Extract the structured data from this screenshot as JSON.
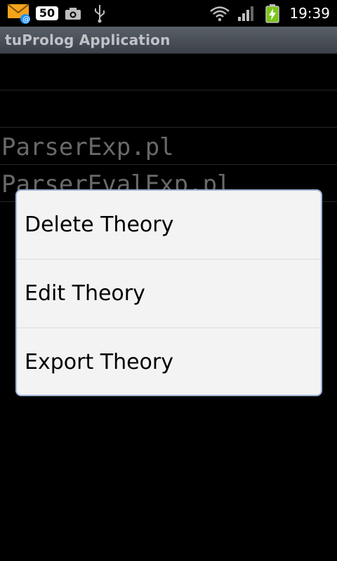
{
  "status_bar": {
    "notification_count": "50",
    "time": "19:39",
    "icons": [
      "mail-icon",
      "camera-icon",
      "usb-icon",
      "wifi-icon",
      "signal-icon",
      "battery-charging-icon"
    ]
  },
  "app": {
    "title": "tuProlog Application"
  },
  "list": {
    "items": [
      "",
      "",
      "ParserExp.pl",
      "ParserEvalExp.pl"
    ]
  },
  "context_menu": {
    "items": [
      "Delete Theory",
      "Edit Theory",
      "Export Theory"
    ]
  },
  "colors": {
    "dialog_bg": "#f3f3f3",
    "dialog_border": "#9eb3d6",
    "title_bar": "#4a5058",
    "list_text": "#8d8d8d"
  }
}
